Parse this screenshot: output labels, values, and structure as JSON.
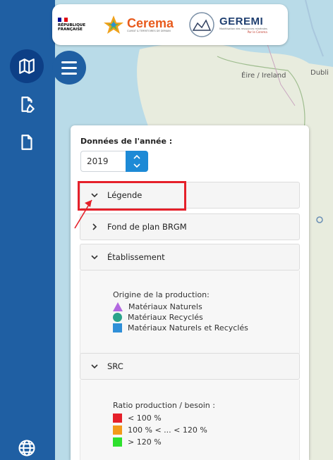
{
  "header": {
    "republique_lines": [
      "RÉPUBLIQUE",
      "FRANÇAISE"
    ],
    "cerema_name": "Cerema",
    "cerema_tagline": "CLIMAT & TERRITOIRES DE DEMAIN",
    "geremi_name": "GEREMI",
    "geremi_tagline": "Modélisation des ressources minérales",
    "geremi_by": "Par le Cerema"
  },
  "map": {
    "labels": [
      "Éire / Ireland",
      "Dubli"
    ]
  },
  "panel": {
    "year_label": "Données de l'année :",
    "year_value": "2019",
    "sections": [
      {
        "label": "Légende",
        "expanded": true
      },
      {
        "label": "Fond de plan BRGM",
        "expanded": false
      },
      {
        "label": "Établissement",
        "expanded": true
      },
      {
        "label": "SRC",
        "expanded": true
      }
    ],
    "etablissement_legend": {
      "title": "Origine de la production:",
      "items": [
        {
          "label": "Matériaux Naturels",
          "icon": "triangle",
          "color": "#b268e0"
        },
        {
          "label": "Matériaux Recyclés",
          "icon": "circle",
          "color": "#2aa38a"
        },
        {
          "label": "Matériaux Naturels et Recyclés",
          "icon": "square",
          "color": "#2f8fd8"
        }
      ]
    },
    "src_legend": {
      "title": "Ratio production / besoin :",
      "items": [
        {
          "label": "< 100 %",
          "color": "#e5202a"
        },
        {
          "label": "100 % < ... < 120 %",
          "color": "#f29a1a"
        },
        {
          "label": "> 120 %",
          "color": "#2ee02e"
        }
      ]
    }
  },
  "colors": {
    "rail": "#1f5fa3",
    "accent": "#1d8ad6",
    "highlight": "#e5202a"
  }
}
